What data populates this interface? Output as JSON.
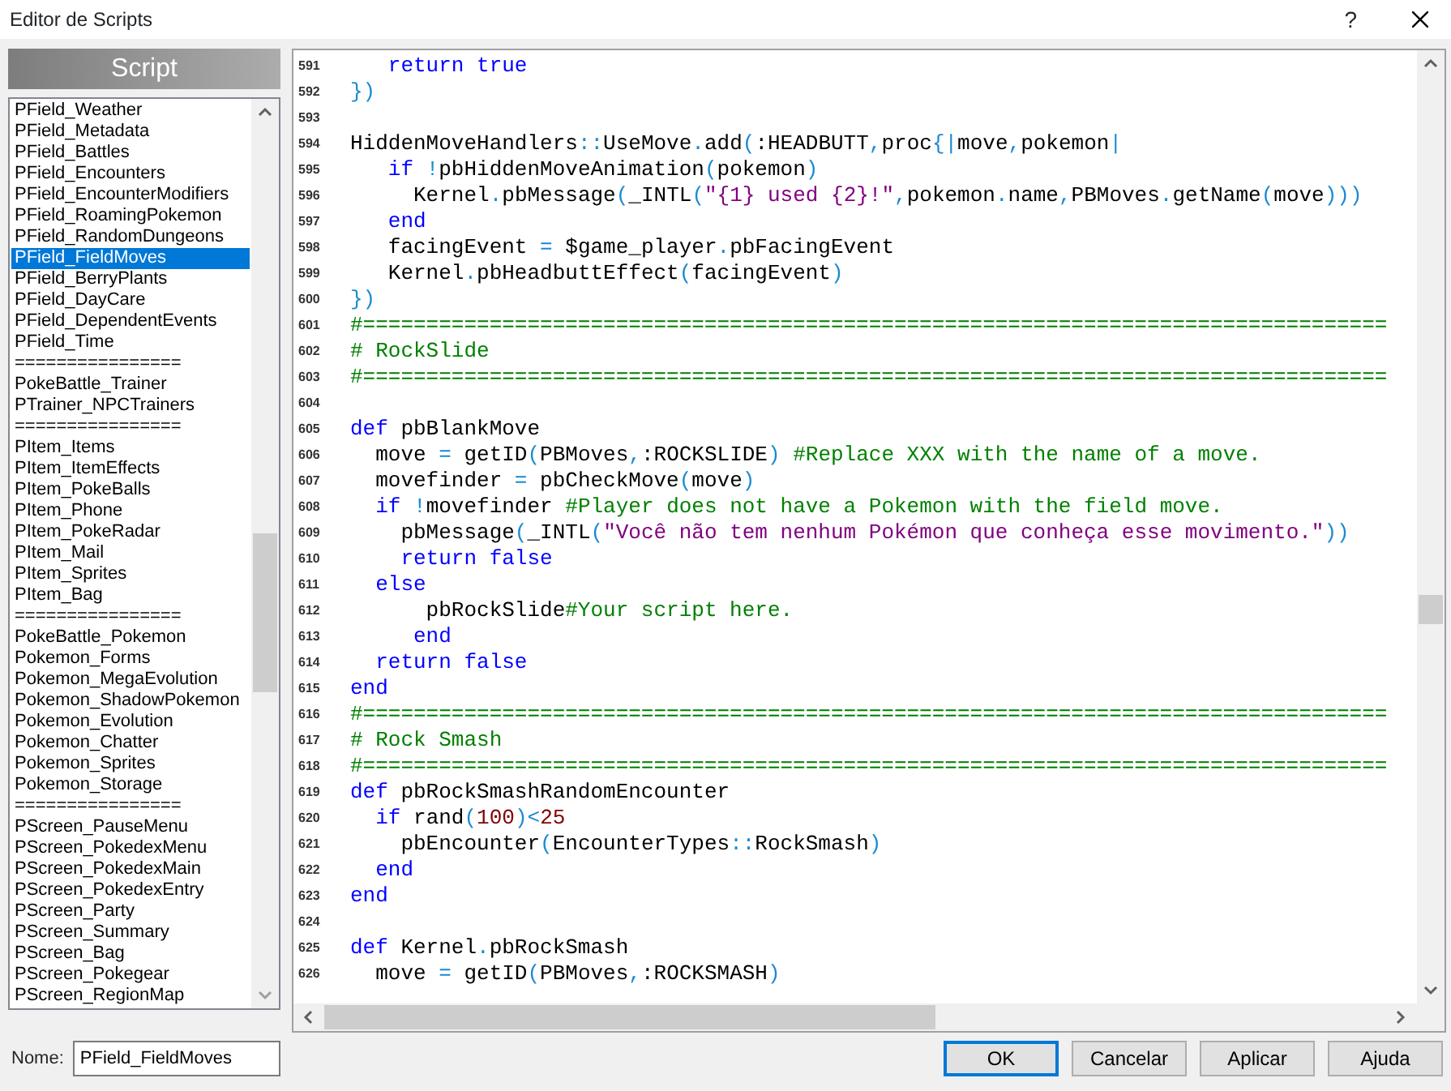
{
  "window": {
    "title": "Editor de Scripts",
    "help": "?"
  },
  "script_list": {
    "header": "Script",
    "items": [
      {
        "label": "PField_Weather",
        "selected": false
      },
      {
        "label": "PField_Metadata",
        "selected": false
      },
      {
        "label": "PField_Battles",
        "selected": false
      },
      {
        "label": "PField_Encounters",
        "selected": false
      },
      {
        "label": "PField_EncounterModifiers",
        "selected": false
      },
      {
        "label": "PField_RoamingPokemon",
        "selected": false
      },
      {
        "label": "PField_RandomDungeons",
        "selected": false
      },
      {
        "label": "PField_FieldMoves",
        "selected": true
      },
      {
        "label": "PField_BerryPlants",
        "selected": false
      },
      {
        "label": "PField_DayCare",
        "selected": false
      },
      {
        "label": "PField_DependentEvents",
        "selected": false
      },
      {
        "label": "PField_Time",
        "selected": false
      },
      {
        "label": "================",
        "selected": false
      },
      {
        "label": "PokeBattle_Trainer",
        "selected": false
      },
      {
        "label": "PTrainer_NPCTrainers",
        "selected": false
      },
      {
        "label": "================",
        "selected": false
      },
      {
        "label": "PItem_Items",
        "selected": false
      },
      {
        "label": "PItem_ItemEffects",
        "selected": false
      },
      {
        "label": "PItem_PokeBalls",
        "selected": false
      },
      {
        "label": "PItem_Phone",
        "selected": false
      },
      {
        "label": "PItem_PokeRadar",
        "selected": false
      },
      {
        "label": "PItem_Mail",
        "selected": false
      },
      {
        "label": "PItem_Sprites",
        "selected": false
      },
      {
        "label": "PItem_Bag",
        "selected": false
      },
      {
        "label": "================",
        "selected": false
      },
      {
        "label": "PokeBattle_Pokemon",
        "selected": false
      },
      {
        "label": "Pokemon_Forms",
        "selected": false
      },
      {
        "label": "Pokemon_MegaEvolution",
        "selected": false
      },
      {
        "label": "Pokemon_ShadowPokemon",
        "selected": false
      },
      {
        "label": "Pokemon_Evolution",
        "selected": false
      },
      {
        "label": "Pokemon_Chatter",
        "selected": false
      },
      {
        "label": "Pokemon_Sprites",
        "selected": false
      },
      {
        "label": "Pokemon_Storage",
        "selected": false
      },
      {
        "label": "================",
        "selected": false
      },
      {
        "label": "PScreen_PauseMenu",
        "selected": false
      },
      {
        "label": "PScreen_PokedexMenu",
        "selected": false
      },
      {
        "label": "PScreen_PokedexMain",
        "selected": false
      },
      {
        "label": "PScreen_PokedexEntry",
        "selected": false
      },
      {
        "label": "PScreen_Party",
        "selected": false
      },
      {
        "label": "PScreen_Summary",
        "selected": false
      },
      {
        "label": "PScreen_Bag",
        "selected": false
      },
      {
        "label": "PScreen_Pokegear",
        "selected": false
      },
      {
        "label": "PScreen_RegionMap",
        "selected": false
      }
    ]
  },
  "editor": {
    "lines": [
      {
        "number": "591",
        "tokens": [
          {
            "kind": "keyword",
            "text": "   return true"
          }
        ]
      },
      {
        "number": "592",
        "tokens": [
          {
            "kind": "operator",
            "text": "})"
          }
        ]
      },
      {
        "number": "593"
      },
      {
        "number": "594",
        "tokens": [
          {
            "kind": "plain",
            "text": "HiddenMoveHandlers"
          },
          {
            "kind": "operator",
            "text": "::"
          },
          {
            "kind": "plain",
            "text": "UseMove"
          },
          {
            "kind": "operator",
            "text": "."
          },
          {
            "kind": "plain",
            "text": "add"
          },
          {
            "kind": "operator",
            "text": "("
          },
          {
            "kind": "plain",
            "text": ":HEADBUTT"
          },
          {
            "kind": "operator",
            "text": ","
          },
          {
            "kind": "plain",
            "text": "proc"
          },
          {
            "kind": "operator",
            "text": "{|"
          },
          {
            "kind": "plain",
            "text": "move"
          },
          {
            "kind": "operator",
            "text": ","
          },
          {
            "kind": "plain",
            "text": "pokemon"
          },
          {
            "kind": "operator",
            "text": "|"
          }
        ]
      },
      {
        "number": "595",
        "tokens": [
          {
            "kind": "keyword",
            "text": "   if "
          },
          {
            "kind": "operator",
            "text": "!"
          },
          {
            "kind": "plain",
            "text": "pbHiddenMoveAnimation"
          },
          {
            "kind": "operator",
            "text": "("
          },
          {
            "kind": "plain",
            "text": "pokemon"
          },
          {
            "kind": "operator",
            "text": ")"
          }
        ]
      },
      {
        "number": "596",
        "tokens": [
          {
            "kind": "plain",
            "text": "     Kernel"
          },
          {
            "kind": "operator",
            "text": "."
          },
          {
            "kind": "plain",
            "text": "pbMessage"
          },
          {
            "kind": "operator",
            "text": "("
          },
          {
            "kind": "plain",
            "text": "_INTL"
          },
          {
            "kind": "operator",
            "text": "("
          },
          {
            "kind": "string",
            "text": "\"{1} used {2}!\""
          },
          {
            "kind": "operator",
            "text": ","
          },
          {
            "kind": "plain",
            "text": "pokemon"
          },
          {
            "kind": "operator",
            "text": "."
          },
          {
            "kind": "plain",
            "text": "name"
          },
          {
            "kind": "operator",
            "text": ","
          },
          {
            "kind": "plain",
            "text": "PBMoves"
          },
          {
            "kind": "operator",
            "text": "."
          },
          {
            "kind": "plain",
            "text": "getName"
          },
          {
            "kind": "operator",
            "text": "("
          },
          {
            "kind": "plain",
            "text": "move"
          },
          {
            "kind": "operator",
            "text": ")))"
          }
        ]
      },
      {
        "number": "597",
        "tokens": [
          {
            "kind": "keyword",
            "text": "   end"
          }
        ]
      },
      {
        "number": "598",
        "tokens": [
          {
            "kind": "plain",
            "text": "   facingEvent "
          },
          {
            "kind": "operator",
            "text": "="
          },
          {
            "kind": "plain",
            "text": " $game_player"
          },
          {
            "kind": "operator",
            "text": "."
          },
          {
            "kind": "plain",
            "text": "pbFacingEvent"
          }
        ]
      },
      {
        "number": "599",
        "tokens": [
          {
            "kind": "plain",
            "text": "   Kernel"
          },
          {
            "kind": "operator",
            "text": "."
          },
          {
            "kind": "plain",
            "text": "pbHeadbuttEffect"
          },
          {
            "kind": "operator",
            "text": "("
          },
          {
            "kind": "plain",
            "text": "facingEvent"
          },
          {
            "kind": "operator",
            "text": ")"
          }
        ]
      },
      {
        "number": "600",
        "tokens": [
          {
            "kind": "operator",
            "text": "})"
          }
        ]
      },
      {
        "number": "601",
        "tokens": [
          {
            "kind": "comment",
            "text": "#================================================================================="
          }
        ]
      },
      {
        "number": "602",
        "tokens": [
          {
            "kind": "comment",
            "text": "# RockSlide"
          }
        ]
      },
      {
        "number": "603",
        "tokens": [
          {
            "kind": "comment",
            "text": "#================================================================================="
          }
        ]
      },
      {
        "number": "604"
      },
      {
        "number": "605",
        "tokens": [
          {
            "kind": "keyword",
            "text": "def"
          },
          {
            "kind": "plain",
            "text": " pbBlankMove"
          }
        ]
      },
      {
        "number": "606",
        "tokens": [
          {
            "kind": "plain",
            "text": "  move "
          },
          {
            "kind": "operator",
            "text": "="
          },
          {
            "kind": "plain",
            "text": " getID"
          },
          {
            "kind": "operator",
            "text": "("
          },
          {
            "kind": "plain",
            "text": "PBMoves"
          },
          {
            "kind": "operator",
            "text": ","
          },
          {
            "kind": "plain",
            "text": ":ROCKSLIDE"
          },
          {
            "kind": "operator",
            "text": ")"
          },
          {
            "kind": "comment",
            "text": " #Replace XXX with the name of a move."
          }
        ]
      },
      {
        "number": "607",
        "tokens": [
          {
            "kind": "plain",
            "text": "  movefinder "
          },
          {
            "kind": "operator",
            "text": "="
          },
          {
            "kind": "plain",
            "text": " pbCheckMove"
          },
          {
            "kind": "operator",
            "text": "("
          },
          {
            "kind": "plain",
            "text": "move"
          },
          {
            "kind": "operator",
            "text": ")"
          }
        ]
      },
      {
        "number": "608",
        "tokens": [
          {
            "kind": "keyword",
            "text": "  if "
          },
          {
            "kind": "operator",
            "text": "!"
          },
          {
            "kind": "plain",
            "text": "movefinder "
          },
          {
            "kind": "comment",
            "text": "#Player does not have a Pokemon with the field move."
          }
        ]
      },
      {
        "number": "609",
        "tokens": [
          {
            "kind": "plain",
            "text": "    pbMessage"
          },
          {
            "kind": "operator",
            "text": "("
          },
          {
            "kind": "plain",
            "text": "_INTL"
          },
          {
            "kind": "operator",
            "text": "("
          },
          {
            "kind": "string",
            "text": "\"Você não tem nenhum Pokémon que conheça esse movimento.\""
          },
          {
            "kind": "operator",
            "text": "))"
          }
        ]
      },
      {
        "number": "610",
        "tokens": [
          {
            "kind": "keyword",
            "text": "    return false"
          }
        ]
      },
      {
        "number": "611",
        "tokens": [
          {
            "kind": "keyword",
            "text": "  else"
          }
        ]
      },
      {
        "number": "612",
        "tokens": [
          {
            "kind": "plain",
            "text": "      pbRockSlide"
          },
          {
            "kind": "comment",
            "text": "#Your script here."
          }
        ]
      },
      {
        "number": "613",
        "tokens": [
          {
            "kind": "keyword",
            "text": "     end"
          }
        ]
      },
      {
        "number": "614",
        "tokens": [
          {
            "kind": "keyword",
            "text": "  return false"
          }
        ]
      },
      {
        "number": "615",
        "tokens": [
          {
            "kind": "keyword",
            "text": "end"
          }
        ]
      },
      {
        "number": "616",
        "tokens": [
          {
            "kind": "comment",
            "text": "#================================================================================="
          }
        ]
      },
      {
        "number": "617",
        "tokens": [
          {
            "kind": "comment",
            "text": "# Rock Smash"
          }
        ]
      },
      {
        "number": "618",
        "tokens": [
          {
            "kind": "comment",
            "text": "#================================================================================="
          }
        ]
      },
      {
        "number": "619",
        "tokens": [
          {
            "kind": "keyword",
            "text": "def"
          },
          {
            "kind": "plain",
            "text": " pbRockSmashRandomEncounter"
          }
        ]
      },
      {
        "number": "620",
        "tokens": [
          {
            "kind": "keyword",
            "text": "  if"
          },
          {
            "kind": "plain",
            "text": " rand"
          },
          {
            "kind": "operator",
            "text": "("
          },
          {
            "kind": "number",
            "text": "100"
          },
          {
            "kind": "operator",
            "text": ")<"
          },
          {
            "kind": "number",
            "text": "25"
          }
        ]
      },
      {
        "number": "621",
        "tokens": [
          {
            "kind": "plain",
            "text": "    pbEncounter"
          },
          {
            "kind": "operator",
            "text": "("
          },
          {
            "kind": "plain",
            "text": "EncounterTypes"
          },
          {
            "kind": "operator",
            "text": "::"
          },
          {
            "kind": "plain",
            "text": "RockSmash"
          },
          {
            "kind": "operator",
            "text": ")"
          }
        ]
      },
      {
        "number": "622",
        "tokens": [
          {
            "kind": "keyword",
            "text": "  end"
          }
        ]
      },
      {
        "number": "623",
        "tokens": [
          {
            "kind": "keyword",
            "text": "end"
          }
        ]
      },
      {
        "number": "624"
      },
      {
        "number": "625",
        "tokens": [
          {
            "kind": "keyword",
            "text": "def"
          },
          {
            "kind": "plain",
            "text": " Kernel"
          },
          {
            "kind": "operator",
            "text": "."
          },
          {
            "kind": "plain",
            "text": "pbRockSmash"
          }
        ]
      },
      {
        "number": "626",
        "tokens": [
          {
            "kind": "plain",
            "text": "  move "
          },
          {
            "kind": "operator",
            "text": "="
          },
          {
            "kind": "plain",
            "text": " getID"
          },
          {
            "kind": "operator",
            "text": "("
          },
          {
            "kind": "plain",
            "text": "PBMoves"
          },
          {
            "kind": "operator",
            "text": ","
          },
          {
            "kind": "plain",
            "text": ":ROCKSMASH"
          },
          {
            "kind": "operator",
            "text": ")"
          }
        ]
      }
    ]
  },
  "name_field": {
    "label": "Nome:",
    "value": "PField_FieldMoves"
  },
  "buttons": [
    {
      "label": "OK",
      "default": true
    },
    {
      "label": "Cancelar",
      "default": false
    },
    {
      "label": "Aplicar",
      "default": false
    },
    {
      "label": "Ajuda",
      "default": false
    }
  ]
}
